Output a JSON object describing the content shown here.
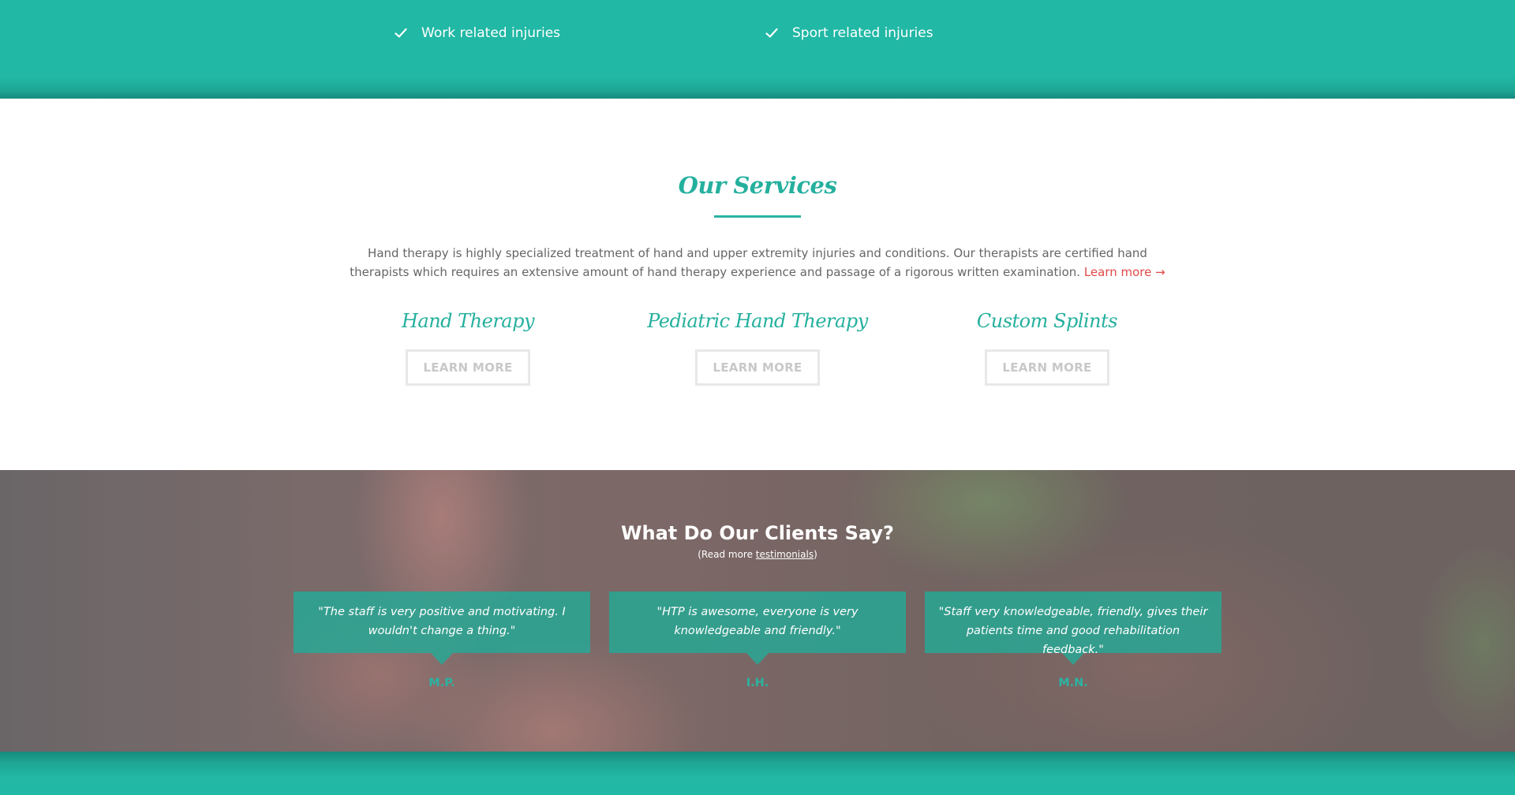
{
  "top_band": {
    "items": [
      {
        "icon": "check-icon",
        "label": "Work related injuries"
      },
      {
        "icon": "check-icon",
        "label": "Sport related injuries"
      }
    ]
  },
  "services": {
    "title": "Our Services",
    "description": "Hand therapy is highly specialized treatment of hand and upper extremity injuries and conditions. Our therapists are certified hand therapists which requires an extensive amount of hand therapy experience and passage of a rigorous written examination.",
    "learn_more_link": "Learn more →",
    "items": [
      {
        "name": "Hand Therapy",
        "button": "LEARN MORE"
      },
      {
        "name": "Pediatric Hand Therapy",
        "button": "LEARN MORE"
      },
      {
        "name": "Custom Splints",
        "button": "LEARN MORE"
      }
    ]
  },
  "testimonials": {
    "title": "What Do Our Clients Say?",
    "sub_prefix": "(Read more ",
    "sub_link": "testimonials",
    "sub_suffix": ")",
    "items": [
      {
        "quote": "\"The staff is very positive and motivating. I wouldn't change a thing.\"",
        "author": "M.P."
      },
      {
        "quote": "\"HTP is awesome, everyone is very knowledgeable and friendly.\"",
        "author": "I.H."
      },
      {
        "quote": "\"Staff very knowledgeable, friendly, gives their patients time and good rehabilitation feedback.\"",
        "author": "M.N."
      }
    ]
  },
  "colors": {
    "teal": "#21b8a5",
    "accent_link": "#e04a47",
    "heading_teal": "#25b09e"
  }
}
